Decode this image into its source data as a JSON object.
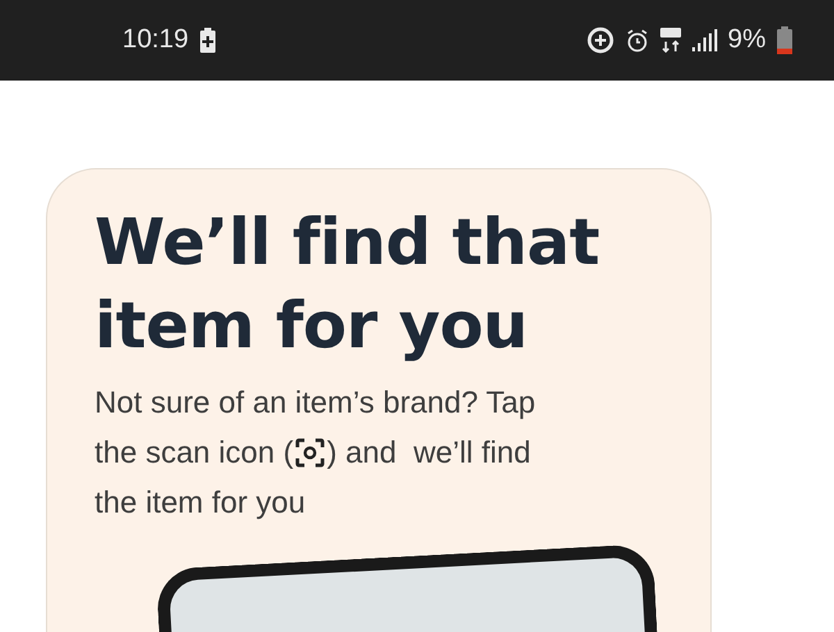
{
  "status_bar": {
    "time": "10:19",
    "battery_percent": "9%"
  },
  "card": {
    "title": "We’ll find that item for you",
    "description_line_1": "Not sure of an item’s brand? Tap",
    "description_line_2_before_icon": "the scan icon (",
    "description_line_2_after_icon": ") and  we’ll find",
    "description_line_3": "the item for you"
  }
}
